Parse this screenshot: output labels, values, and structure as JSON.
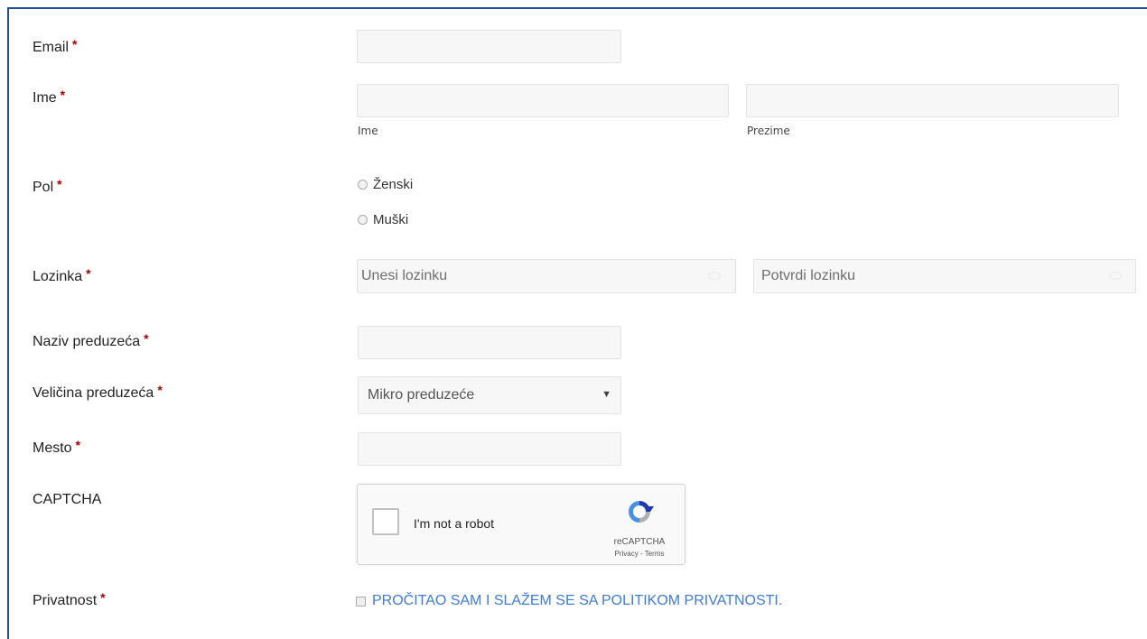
{
  "form": {
    "email": {
      "label": "Email",
      "value": ""
    },
    "name": {
      "label": "Ime",
      "first_value": "",
      "first_sublabel": "Ime",
      "last_value": "",
      "last_sublabel": "Prezime"
    },
    "gender": {
      "label": "Pol",
      "options": [
        "Ženski",
        "Muški"
      ]
    },
    "password": {
      "label": "Lozinka",
      "placeholder": "Unesi lozinku",
      "confirm_placeholder": "Potvrdi lozinku"
    },
    "company_name": {
      "label": "Naziv preduzeća",
      "value": ""
    },
    "company_size": {
      "label": "Veličina preduzeća",
      "selected": "Mikro preduzeće"
    },
    "city": {
      "label": "Mesto",
      "value": ""
    },
    "captcha": {
      "label": "CAPTCHA",
      "checkbox_text": "I'm not a robot",
      "brand": "reCAPTCHA",
      "links": "Privacy - Terms"
    },
    "privacy": {
      "label": "Privatnost",
      "link_text": "PROČITAO SAM I SLAŽEM SE SA POLITIKOM PRIVATNOSTI."
    },
    "required_marker": "*"
  },
  "colors": {
    "frame_border": "#1f4e9a",
    "required": "#a80000",
    "link": "#3e7bd6",
    "field_bg": "#f7f7f7"
  }
}
